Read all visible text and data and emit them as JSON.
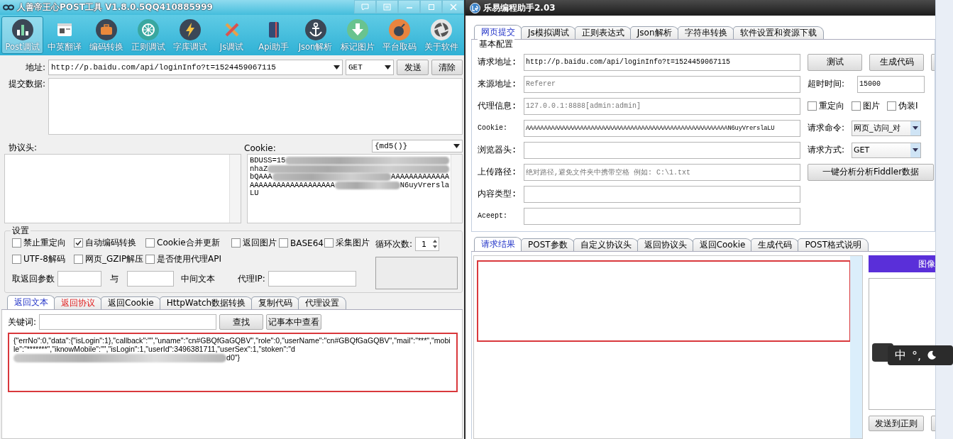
{
  "left_window": {
    "title": "人善帝王心POST工具 V1.8.0.5QQ410885999",
    "toolbar": [
      {
        "label": "Post调试",
        "selected": true,
        "kind": "chart"
      },
      {
        "label": "中英翻译",
        "selected": false,
        "kind": "window"
      },
      {
        "label": "编码转换",
        "selected": false,
        "kind": "briefcase"
      },
      {
        "label": "正则调试",
        "selected": false,
        "kind": "wheel"
      },
      {
        "label": "字库调试",
        "selected": false,
        "kind": "bolt"
      },
      {
        "label": "Js调试",
        "selected": false,
        "kind": "tools"
      },
      {
        "label": "Api助手",
        "selected": false,
        "kind": "book"
      },
      {
        "label": "Json解析",
        "selected": false,
        "kind": "anchor"
      },
      {
        "label": "标记图片",
        "selected": false,
        "kind": "download"
      },
      {
        "label": "平台取码",
        "selected": false,
        "kind": "bomb"
      },
      {
        "label": "关于软件",
        "selected": false,
        "kind": "aperture"
      }
    ],
    "address": {
      "label": "地址:",
      "value": "http://p.baidu.com/api/loginInfo?t=1524459067115",
      "method": "GET",
      "send": "发送",
      "clear": "清除"
    },
    "post_data_label": "提交数据:",
    "headers_label": "协议头:",
    "cookie_label": "Cookie:",
    "cookie_format": "{md5()}",
    "cookie_lines": [
      {
        "before": "BDUSS=15",
        "redacted": true
      },
      {
        "before": "nhaZ",
        "redacted": true
      },
      {
        "before": "bQAAA",
        "redacted": true,
        "after": "AAAAAAAAAAAAA"
      },
      {
        "before": "AAAAAAAAAAAAAAAAAAA",
        "redacted": true,
        "after": "N6uyVrersla"
      },
      {
        "before": "LU",
        "redacted": false
      }
    ],
    "settings": {
      "title": "设置",
      "option_rows": [
        [
          {
            "label": "禁止重定向",
            "checked": false
          },
          {
            "label": "自动编码转换",
            "checked": true
          },
          {
            "label": "Cookie合并更新",
            "checked": false
          },
          {
            "label": "返回图片",
            "checked": false
          },
          {
            "label": "BASE64",
            "checked": false
          },
          {
            "label": "采集图片",
            "checked": false
          }
        ],
        [
          {
            "label": "UTF-8解码",
            "checked": false
          },
          {
            "label": "网页_GZIP解压",
            "checked": false
          },
          {
            "label": "是否使用代理API",
            "checked": false
          }
        ]
      ],
      "loop_label": "循环次数:",
      "loop_value": "1",
      "extract_label": "取返回参数",
      "and_label": "与",
      "middle_label": "中间文本",
      "proxy_ip_label": "代理IP:"
    },
    "tabs": [
      {
        "label": "返回文本",
        "selected": true,
        "kind": "plain"
      },
      {
        "label": "返回协议",
        "selected": false,
        "kind": "alert"
      },
      {
        "label": "返回Cookie",
        "selected": false,
        "kind": "plain"
      },
      {
        "label": "HttpWatch数据转换",
        "selected": false,
        "kind": "plain"
      },
      {
        "label": "复制代码",
        "selected": false,
        "kind": "plain"
      },
      {
        "label": "代理设置",
        "selected": false,
        "kind": "plain"
      }
    ],
    "keyword_label": "关键词:",
    "find": "查找",
    "notepad": "记事本中查看",
    "response": {
      "highlighted": true,
      "text": "{\"errNo\":0,\"data\":{\"isLogin\":1},\"callback\":\"\",\"uname\":\"cn#GBQfGaGQBV\",\"role\":0,\"userName\":\"cn#GBQfGaGQBV\",\"mail\":\"***\",\"mobile\":\"*******\",\"iknowMobile\":\"\",\"isLogin\":1,\"userId\":3496381711,\"userSex\":1,\"stoken\":\"d",
      "redacted": true,
      "tail": "d0\"}"
    }
  },
  "right_window": {
    "title": "乐易编程助手2.03",
    "tabs": [
      {
        "label": "网页提交",
        "selected": true
      },
      {
        "label": "Js模拟调试",
        "selected": false
      },
      {
        "label": "正则表达式",
        "selected": false
      },
      {
        "label": "Json解析",
        "selected": false
      },
      {
        "label": "字符串转换",
        "selected": false
      },
      {
        "label": "软件设置和资源下载",
        "selected": false
      }
    ],
    "group_title": "基本配置",
    "fields": [
      {
        "label": "请求地址:",
        "value": "http://p.baidu.com/api/loginInfo?t=1524459067115"
      },
      {
        "label": "来源地址:",
        "placeholder": "Referer"
      },
      {
        "label": "代理信息:",
        "placeholder": "127.0.0.1:8888[admin:admin]"
      },
      {
        "label": "Cookie:",
        "value": "AAAAAAAAAAAAAAAAAAAAAAAAAAAAAAAAAAAAAAAAAAAAAAAAAAAAAAAAN6uyVrerslaLU"
      },
      {
        "label": "浏览器头:"
      },
      {
        "label": "上传路径:",
        "placeholder": "绝对路径,避免文件夹中携带空格 例如: C:\\1.txt"
      },
      {
        "label": "内容类型:"
      },
      {
        "label": "Aceept:"
      }
    ],
    "side": [
      {
        "kind": "buttons",
        "buttons": [
          "测试",
          "生成代码"
        ]
      },
      {
        "kind": "input",
        "label": "超时时间:",
        "value": "15000"
      },
      {
        "kind": "checks",
        "checks": [
          {
            "label": "重定向",
            "checked": false
          },
          {
            "label": "图片",
            "checked": false
          },
          {
            "label": "伪装I",
            "checked": false
          }
        ]
      },
      {
        "kind": "select",
        "label": "请求命令:",
        "value": "网页_访问_对"
      },
      {
        "kind": "select",
        "label": "请求方式:",
        "value": "GET"
      },
      {
        "kind": "button",
        "label": "一键分析分析Fiddler数据"
      }
    ],
    "result_tabs": [
      {
        "label": "请求结果",
        "selected": true
      },
      {
        "label": "POST参数",
        "selected": false
      },
      {
        "label": "自定义协议头",
        "selected": false
      },
      {
        "label": "返回协议头",
        "selected": false
      },
      {
        "label": "返回Cookie",
        "selected": false
      },
      {
        "label": "生成代码",
        "selected": false
      },
      {
        "label": "POST格式说明",
        "selected": false
      }
    ],
    "result": {
      "highlighted": true
    },
    "image_panel": {
      "title": "图像",
      "send_button": "发送到正则"
    }
  },
  "ime": {
    "mode": "中",
    "punctuation": "°,"
  }
}
